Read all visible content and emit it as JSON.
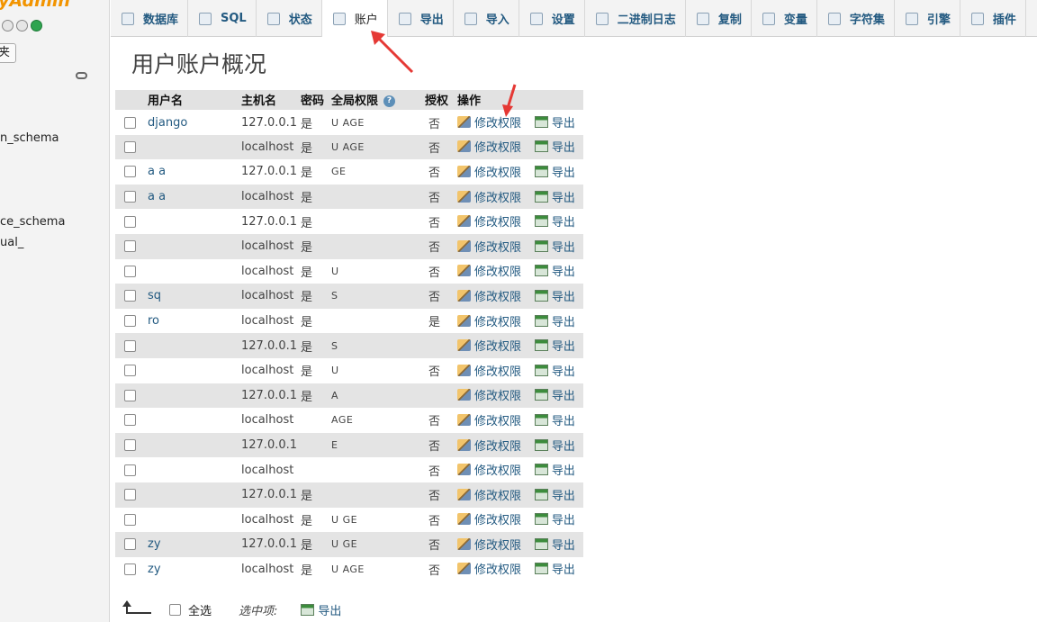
{
  "sidebar": {
    "logo": "yAdmin",
    "favorites": "夹",
    "databases": [
      "n_schema",
      "ce_schema",
      "ual_"
    ]
  },
  "tabs": [
    {
      "label": "数据库",
      "icon": "database-icon"
    },
    {
      "label": "SQL",
      "icon": "sql-icon"
    },
    {
      "label": "状态",
      "icon": "status-icon"
    },
    {
      "label": "账户",
      "icon": "accounts-icon",
      "active": true
    },
    {
      "label": "导出",
      "icon": "export-icon"
    },
    {
      "label": "导入",
      "icon": "import-icon"
    },
    {
      "label": "设置",
      "icon": "settings-icon"
    },
    {
      "label": "二进制日志",
      "icon": "binlog-icon"
    },
    {
      "label": "复制",
      "icon": "replication-icon"
    },
    {
      "label": "变量",
      "icon": "variables-icon"
    },
    {
      "label": "字符集",
      "icon": "charset-icon"
    },
    {
      "label": "引擎",
      "icon": "engine-icon"
    },
    {
      "label": "插件",
      "icon": "plugin-icon"
    }
  ],
  "page_title": "用户账户概况",
  "table": {
    "headers": {
      "user": "用户名",
      "host": "主机名",
      "password": "密码",
      "global_privileges": "全局权限",
      "help": "?",
      "grant": "授权",
      "action": "操作"
    },
    "edit_label": "修改权限",
    "export_label": "导出",
    "rows": [
      {
        "user": "django",
        "host": "127.0.0.1",
        "password": "是",
        "priv": "U AGE",
        "grant": "否"
      },
      {
        "user": "",
        "host": "localhost",
        "password": "是",
        "priv": "U AGE",
        "grant": "否"
      },
      {
        "user": "a a",
        "host": "127.0.0.1",
        "password": "是",
        "priv": "GE",
        "grant": "否"
      },
      {
        "user": "a a",
        "host": "localhost",
        "password": "是",
        "priv": "",
        "grant": "否"
      },
      {
        "user": "",
        "host": "127.0.0.1",
        "password": "是",
        "priv": "",
        "grant": "否"
      },
      {
        "user": "",
        "host": "localhost",
        "password": "是",
        "priv": "",
        "grant": "否"
      },
      {
        "user": "",
        "host": "localhost",
        "password": "是",
        "priv": "U",
        "grant": "否"
      },
      {
        "user": "sq",
        "host": "localhost",
        "password": "是",
        "priv": "S",
        "grant": "否"
      },
      {
        "user": "ro",
        "host": "localhost",
        "password": "是",
        "priv": "",
        "grant": "是"
      },
      {
        "user": "",
        "host": "127.0.0.1",
        "password": "是",
        "priv": "S",
        "grant": ""
      },
      {
        "user": "",
        "host": "localhost",
        "password": "是",
        "priv": "U",
        "grant": "否"
      },
      {
        "user": "",
        "host": "127.0.0.1",
        "password": "是",
        "priv": "A",
        "grant": ""
      },
      {
        "user": "",
        "host": "localhost",
        "password": "",
        "priv": "AGE",
        "grant": "否"
      },
      {
        "user": "",
        "host": "127.0.0.1",
        "password": "",
        "priv": "E",
        "grant": "否"
      },
      {
        "user": "",
        "host": "localhost",
        "password": "",
        "priv": "",
        "grant": "否"
      },
      {
        "user": "",
        "host": "127.0.0.1",
        "password": "是",
        "priv": "",
        "grant": "否"
      },
      {
        "user": "",
        "host": "localhost",
        "password": "是",
        "priv": "U GE",
        "grant": "否"
      },
      {
        "user": "zy",
        "host": "127.0.0.1",
        "password": "是",
        "priv": "U GE",
        "grant": "否"
      },
      {
        "user": "zy",
        "host": "localhost",
        "password": "是",
        "priv": "U AGE",
        "grant": "否"
      }
    ]
  },
  "footer": {
    "select_all": "全选",
    "with_selected": "选中项:",
    "export": "导出"
  },
  "colors": {
    "accent": "#235a81",
    "annotation": "#e53935"
  }
}
